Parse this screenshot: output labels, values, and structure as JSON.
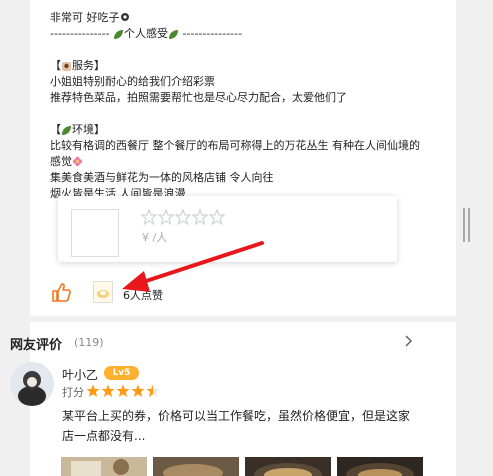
{
  "post": {
    "lines": [
      "非常可 好吃子",
      "--------------- 个人感受 ---------------",
      "",
      "【 服务】",
      "小姐姐特别耐心的给我们介绍彩票",
      "推荐特色菜品，拍照需要帮忙也是尽心尽力配合，太爱他们了",
      "",
      "【 环境】",
      "比较有格调的西餐厅 整个餐厅的布局可称得上的万花丛生 有种在人间仙境的",
      "感觉",
      "集美食美酒与鲜花为一体的风格店铺 令人向往",
      "烟火皆是生活 人间皆是浪漫"
    ]
  },
  "shop_card": {
    "price": "¥ /人",
    "rating": 0
  },
  "likes": {
    "count_label": "6人点赞"
  },
  "reviews": {
    "title": "网友评价",
    "count": "(119)",
    "items": [
      {
        "name": "叶小乙",
        "level": "Lv5",
        "score_label": "打分",
        "rating": 4.5,
        "text": "某平台上买的券，价格可以当工作餐吃，虽然价格便宜，但是这家店一点都没有...",
        "photo_count": 4
      }
    ]
  },
  "colors": {
    "star_orange": "#ff9a14",
    "like_orange": "#f5741a",
    "arrow_red": "#e8171b",
    "level_badge": "#ffb02e",
    "leaf_green": "#4a8a2c"
  },
  "icons": {
    "thumb": "thumbs-up-icon",
    "chevron": "chevron-right-icon",
    "leaf": "leaf-icon"
  }
}
